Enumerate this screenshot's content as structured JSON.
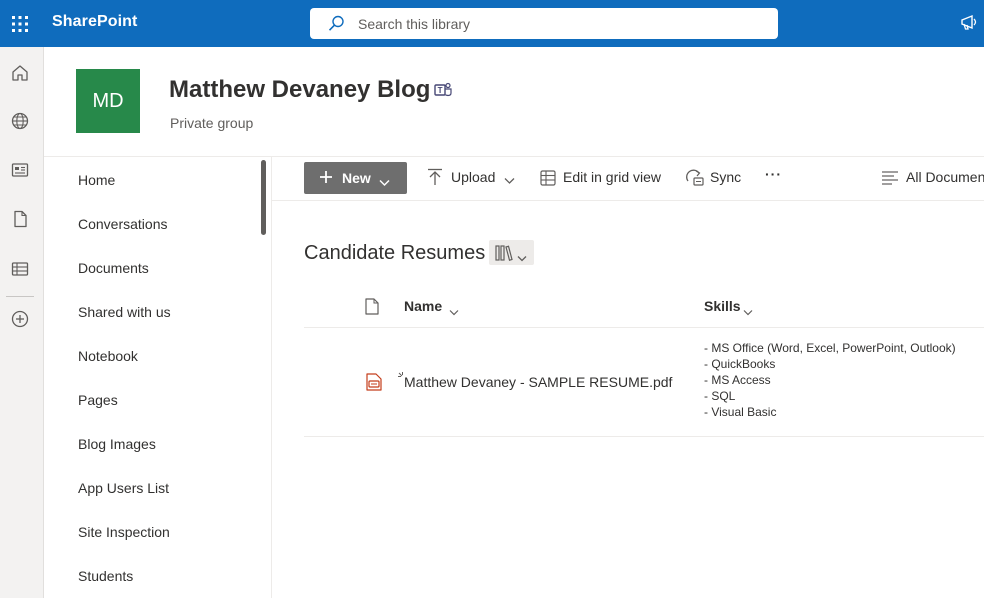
{
  "suite": {
    "brand": "SharePoint",
    "search_placeholder": "Search this library"
  },
  "site": {
    "logo_initials": "MD",
    "logo_color": "#27894a",
    "title": "Matthew Devaney Blog",
    "subtitle": "Private group"
  },
  "nav": {
    "items": [
      "Home",
      "Conversations",
      "Documents",
      "Shared with us",
      "Notebook",
      "Pages",
      "Blog Images",
      "App Users List",
      "Site Inspection",
      "Students"
    ]
  },
  "commands": {
    "new_label": "New",
    "upload_label": "Upload",
    "grid_label": "Edit in grid view",
    "sync_label": "Sync",
    "more_label": "···",
    "view_label": "All Documents"
  },
  "library": {
    "title": "Candidate Resumes",
    "columns": {
      "name": "Name",
      "skills": "Skills"
    },
    "rows": [
      {
        "name": "Matthew Devaney - SAMPLE RESUME.pdf",
        "skills": [
          "- MS Office (Word, Excel, PowerPoint, Outlook)",
          "- QuickBooks",
          "- MS Access",
          "- SQL",
          "- Visual Basic"
        ]
      }
    ]
  },
  "colors": {
    "suite_bar": "#0f6cbd",
    "new_button": "#6e6e6e",
    "pdf_icon": "#c43e1c"
  }
}
